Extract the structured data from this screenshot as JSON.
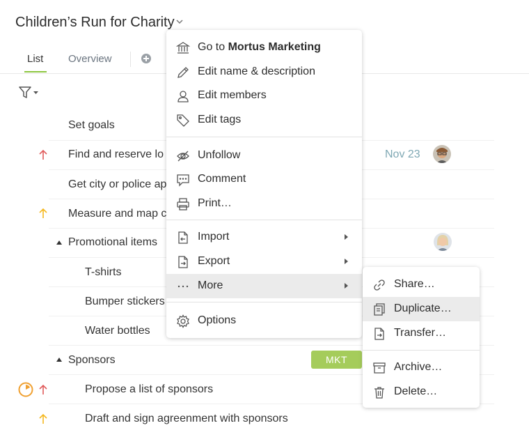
{
  "header": {
    "project_title": "Children’s Run for Charity"
  },
  "tabs": [
    {
      "label": "List",
      "active": true
    },
    {
      "label": "Overview",
      "active": false
    }
  ],
  "tasks": [
    {
      "name": "Set goals"
    },
    {
      "name": "Find and reserve lo",
      "priority": "high",
      "due": "Nov 23"
    },
    {
      "name": "Get city or police ap"
    },
    {
      "name": "Measure and map c",
      "priority": "medium"
    },
    {
      "name": "Promotional items",
      "group": true
    },
    {
      "name": "T-shirts"
    },
    {
      "name": "Bumper stickers"
    },
    {
      "name": "Water bottles"
    },
    {
      "name": "Sponsors",
      "group": true,
      "tag": "MKT"
    },
    {
      "name": "Propose a list of sponsors",
      "priority": "high"
    },
    {
      "name": "Draft and sign agreenment with sponsors",
      "priority": "medium"
    }
  ],
  "context_menu": {
    "goto_prefix": "Go to ",
    "goto_target": "Mortus Marketing",
    "items": [
      "Edit name & description",
      "Edit members",
      "Edit tags",
      "Unfollow",
      "Comment",
      "Print…",
      "Import",
      "Export",
      "More",
      "Options"
    ]
  },
  "submenu": {
    "items": [
      "Share…",
      "Duplicate…",
      "Transfer…",
      "Archive…",
      "Delete…"
    ]
  },
  "colors": {
    "accent": "#8cc63f",
    "priority_high": "#e05c5c",
    "priority_medium": "#f5b820",
    "tag_bg": "#a5cc5b",
    "date": "#7fa8b4"
  }
}
